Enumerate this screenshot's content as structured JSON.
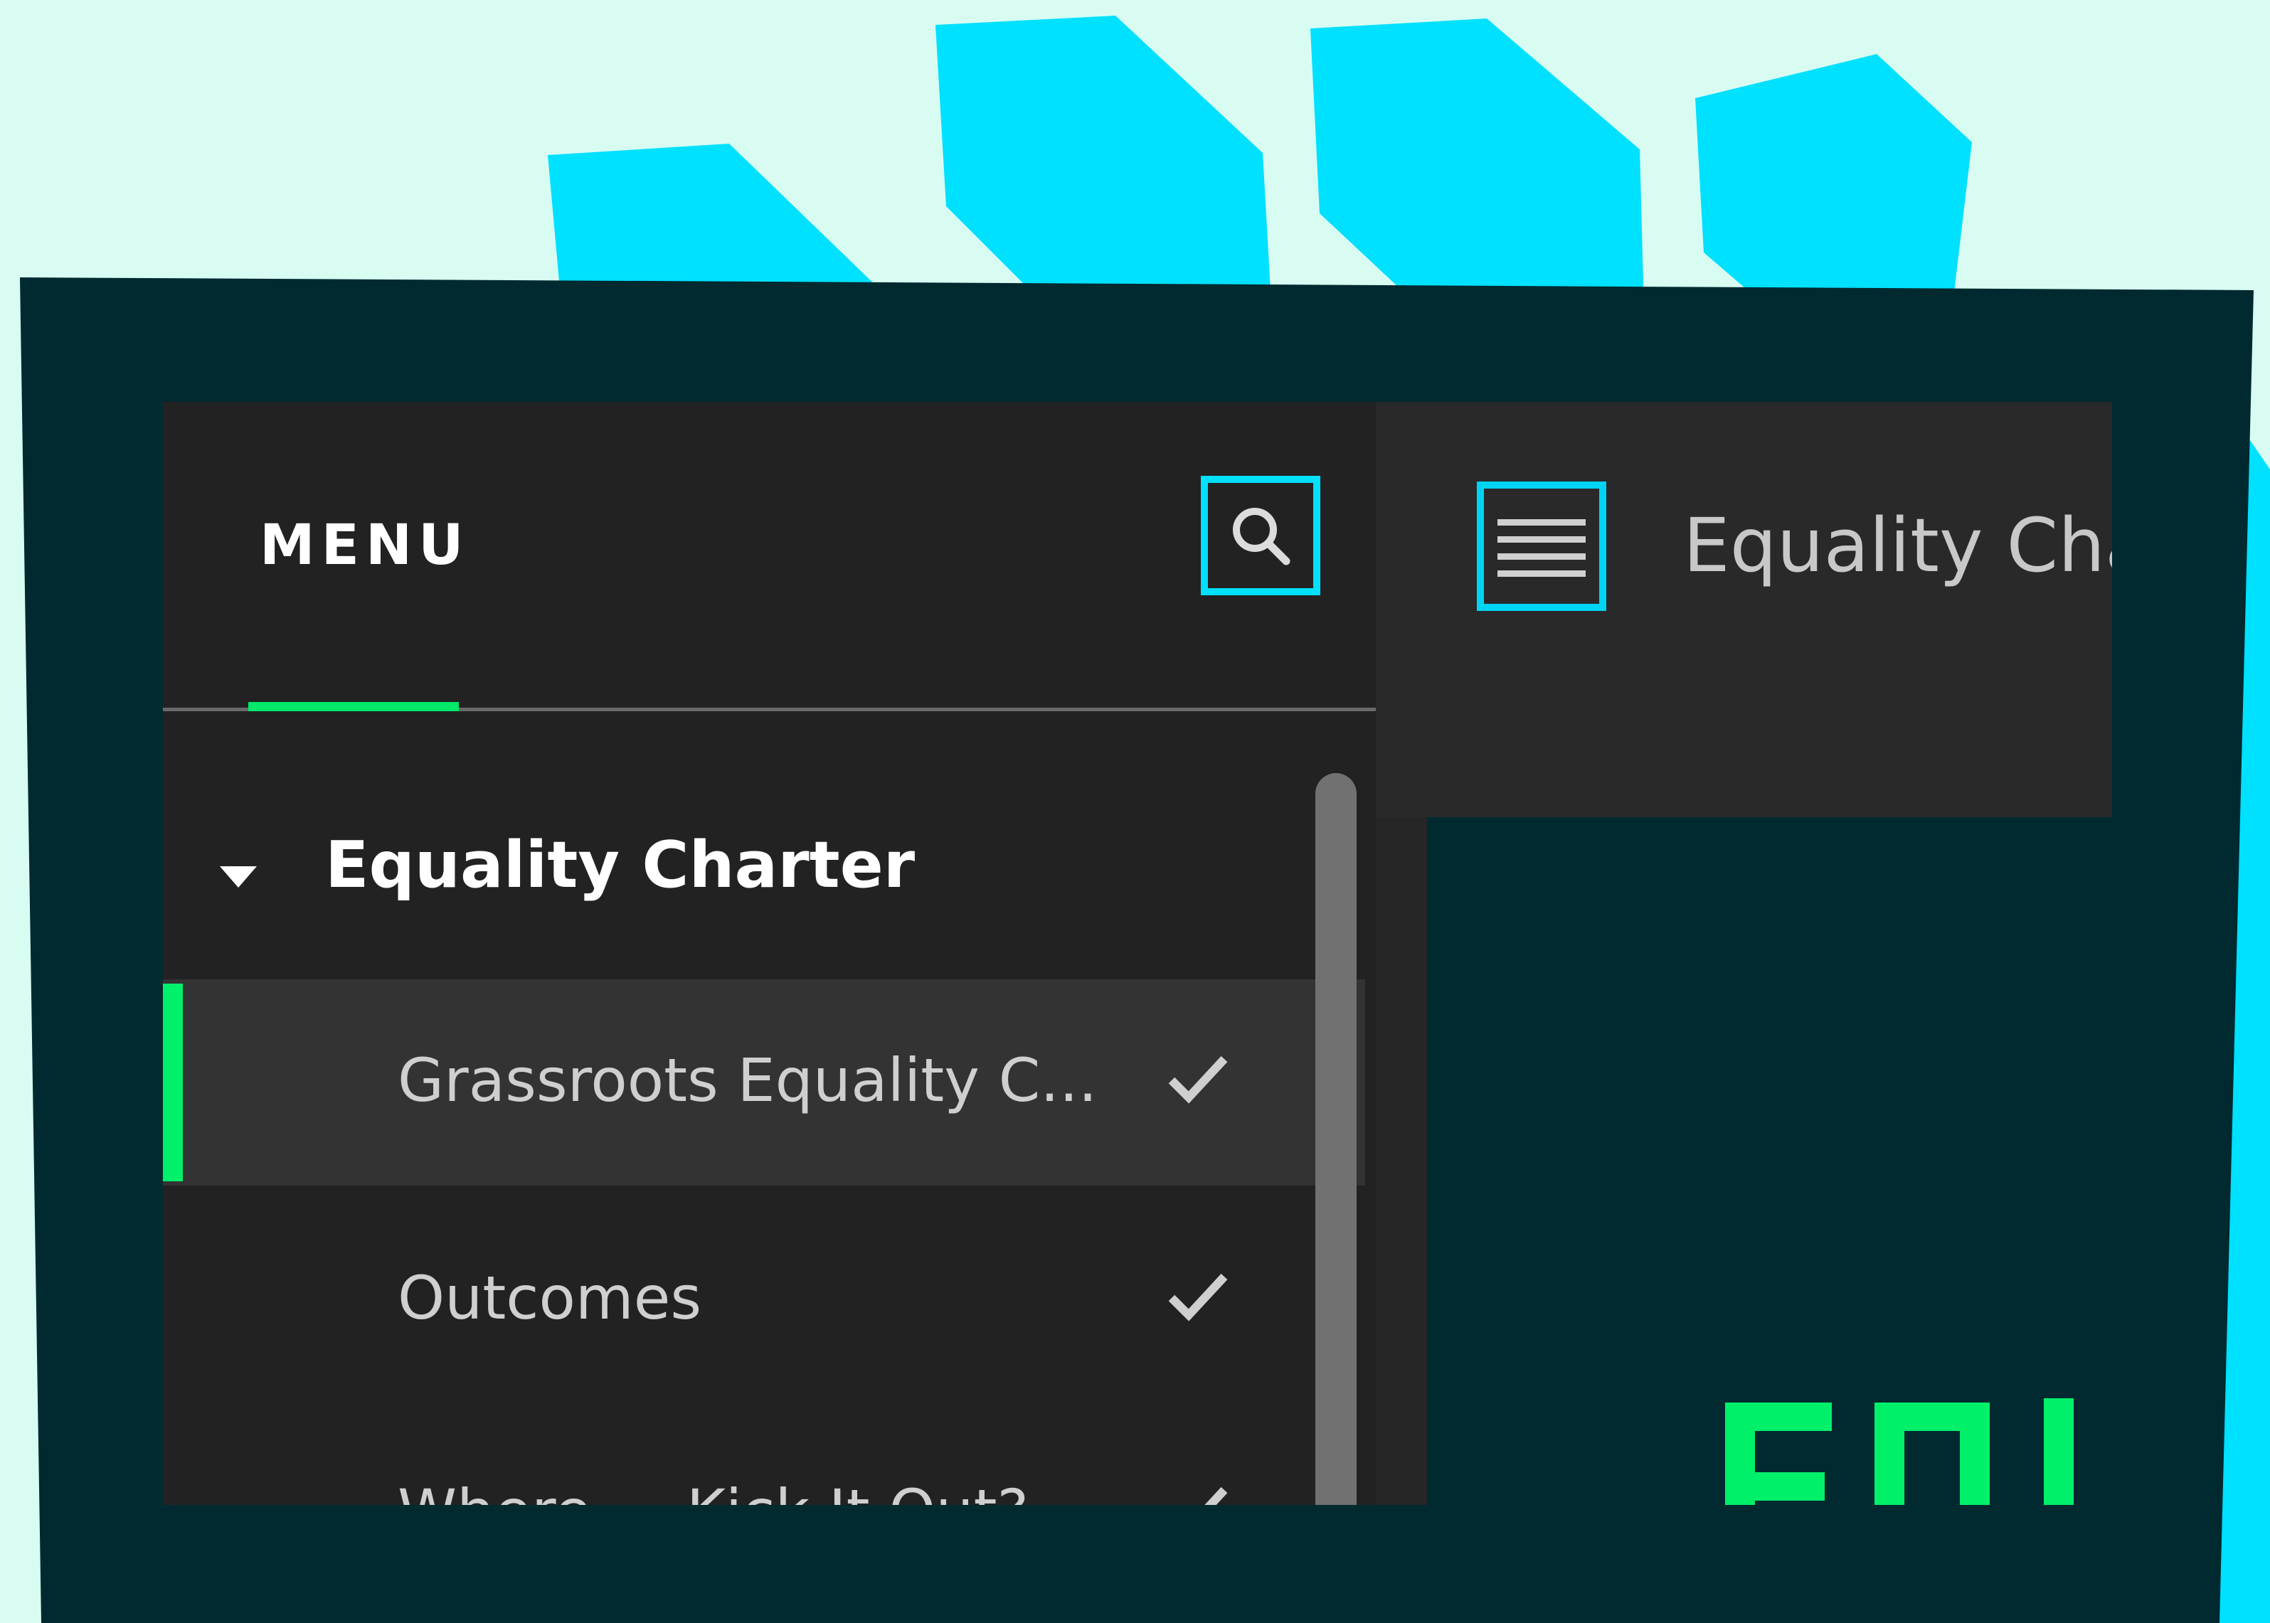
{
  "colors": {
    "background": "#d8fcf2",
    "frame": "#002a30",
    "decor_cyan": "#00e0ff",
    "accent_green": "#00f06a",
    "focus_ring": "#00d4f4",
    "panel": "#222222",
    "main_header": "#292929"
  },
  "sidebar": {
    "menu_label": "MENU",
    "search_icon": "search-icon",
    "section": {
      "title": "Equality Charter",
      "expanded": true,
      "caret_icon": "caret-down-icon"
    },
    "items": [
      {
        "label": "Grassroots Equality C...",
        "active": true,
        "completed": true,
        "icon": "check-icon"
      },
      {
        "label": "Outcomes",
        "active": false,
        "completed": true,
        "icon": "check-icon"
      },
      {
        "label": "Where ... Kick It Out?",
        "active": false,
        "completed": true,
        "icon": "check-icon"
      }
    ]
  },
  "main": {
    "menu_toggle_icon": "hamburger-icon",
    "title": "Equality Cha",
    "logo_fragment": "EQI"
  }
}
